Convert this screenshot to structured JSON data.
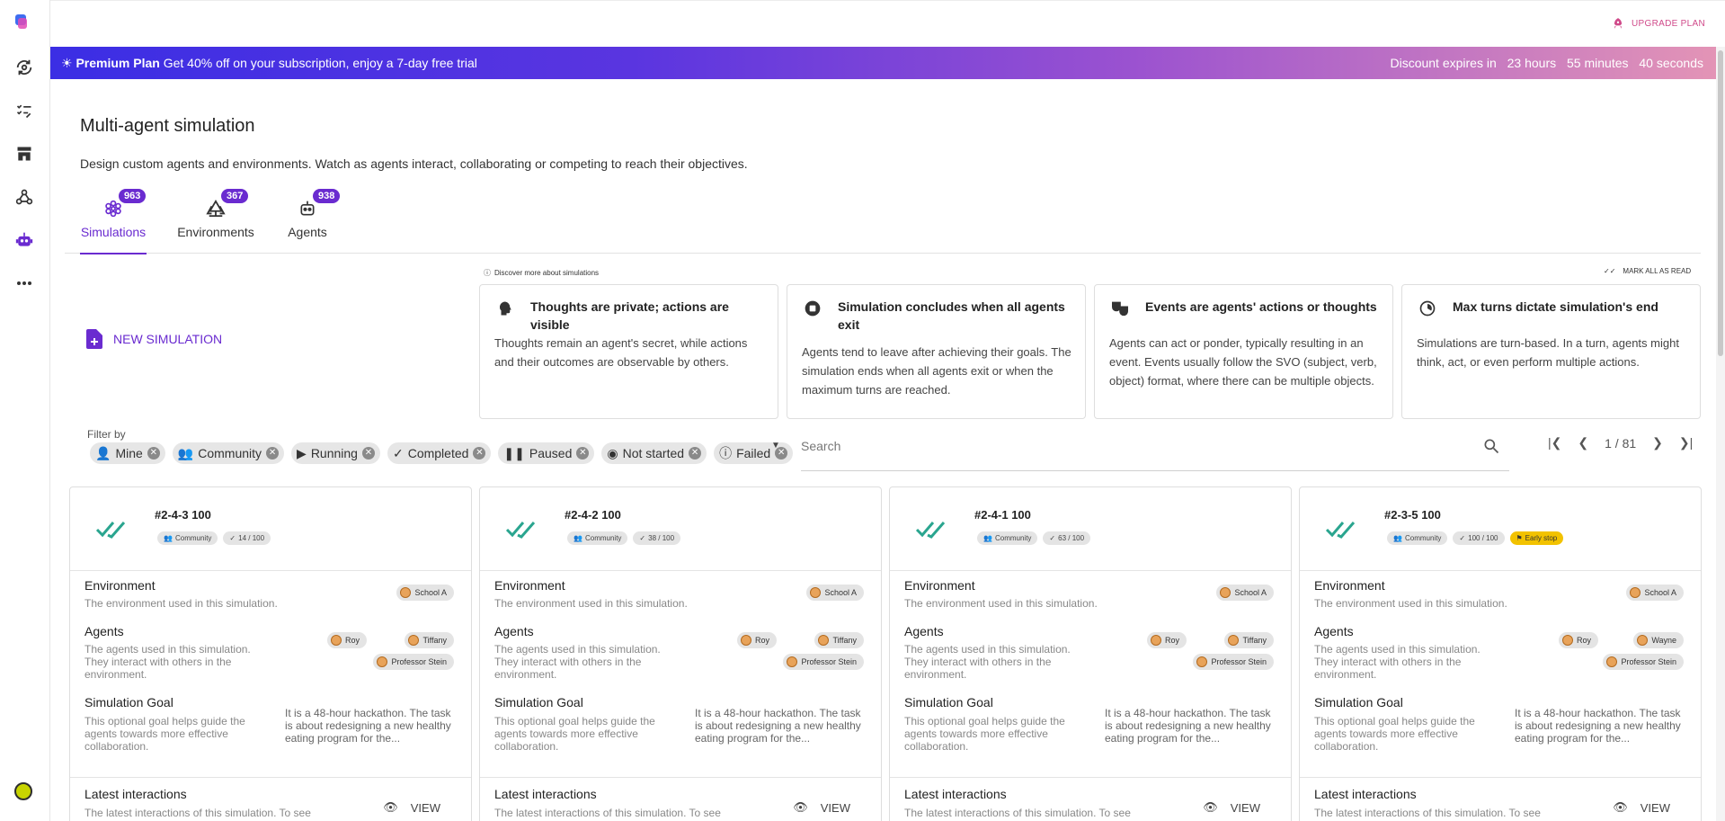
{
  "topbar": {
    "upgrade_label": "UPGRADE PLAN"
  },
  "banner": {
    "plan": "Premium Plan",
    "offer": "Get 40% off on your subscription, enjoy a 7-day free trial",
    "expires_label": "Discount expires in",
    "hours": "23 hours",
    "minutes": "55 minutes",
    "seconds": "40 seconds"
  },
  "header": {
    "title": "Multi-agent simulation",
    "subtitle": "Design custom agents and environments. Watch as agents interact, collaborating or competing to reach their objectives."
  },
  "tabs": [
    {
      "label": "Simulations",
      "count": "963"
    },
    {
      "label": "Environments",
      "count": "367"
    },
    {
      "label": "Agents",
      "count": "938"
    }
  ],
  "new_simulation_label": "NEW SIMULATION",
  "discover_label": "Discover more about simulations",
  "mark_all_label": "MARK ALL AS READ",
  "info_cards": [
    {
      "title": "Thoughts are private; actions are visible",
      "text": "Thoughts remain an agent's secret, while actions and their outcomes are observable by others."
    },
    {
      "title": "Simulation concludes when all agents exit",
      "text": "Agents tend to leave after achieving their goals. The simulation ends when all agents exit or when the maximum turns are reached."
    },
    {
      "title": "Events are agents' actions or thoughts",
      "text": "Agents can act or ponder, typically resulting in an event. Events usually follow the SVO (subject, verb, object) format, where there can be multiple objects."
    },
    {
      "title": "Max turns dictate simulation's end",
      "text": "Simulations are turn-based. In a turn, agents might think, act, or even perform multiple actions."
    }
  ],
  "filter": {
    "label": "Filter by",
    "chips": [
      "Mine",
      "Community",
      "Running",
      "Completed",
      "Paused",
      "Not started",
      "Failed"
    ]
  },
  "search": {
    "placeholder": "Search"
  },
  "pager": {
    "text": "1 / 81"
  },
  "sections": {
    "env_title": "Environment",
    "env_desc": "The environment used in this simulation.",
    "agents_title": "Agents",
    "agents_desc": "The agents used in this simulation. They interact with others in the environment.",
    "goal_title": "Simulation Goal",
    "goal_desc": "This optional goal helps guide the agents towards more effective collaboration.",
    "latest_title": "Latest interactions",
    "latest_desc": "The latest interactions of this simulation. To see",
    "view_label": "VIEW"
  },
  "simulations": [
    {
      "name": "#2-4-3 100",
      "tag_community": "Community",
      "turns": "14 / 100",
      "env": "School A",
      "agents": [
        "Roy",
        "Tiffany",
        "Professor Stein"
      ],
      "goal": "It is a 48-hour hackathon. The task is about redesigning a new healthy eating program for the..."
    },
    {
      "name": "#2-4-2 100",
      "tag_community": "Community",
      "turns": "38 / 100",
      "env": "School A",
      "agents": [
        "Roy",
        "Tiffany",
        "Professor Stein"
      ],
      "goal": "It is a 48-hour hackathon. The task is about redesigning a new healthy eating program for the..."
    },
    {
      "name": "#2-4-1 100",
      "tag_community": "Community",
      "turns": "63 / 100",
      "env": "School A",
      "agents": [
        "Roy",
        "Tiffany",
        "Professor Stein"
      ],
      "goal": "It is a 48-hour hackathon. The task is about redesigning a new healthy eating program for the..."
    },
    {
      "name": "#2-3-5 100",
      "tag_community": "Community",
      "turns": "100 / 100",
      "early": "Early stop",
      "env": "School A",
      "agents": [
        "Roy",
        "Wayne",
        "Professor Stein"
      ],
      "goal": "It is a 48-hour hackathon. The task is about redesigning a new healthy eating program for the..."
    }
  ],
  "colors": {
    "accent": "#6a2bd0",
    "check": "#2aa58f",
    "early": "#f2c200"
  }
}
